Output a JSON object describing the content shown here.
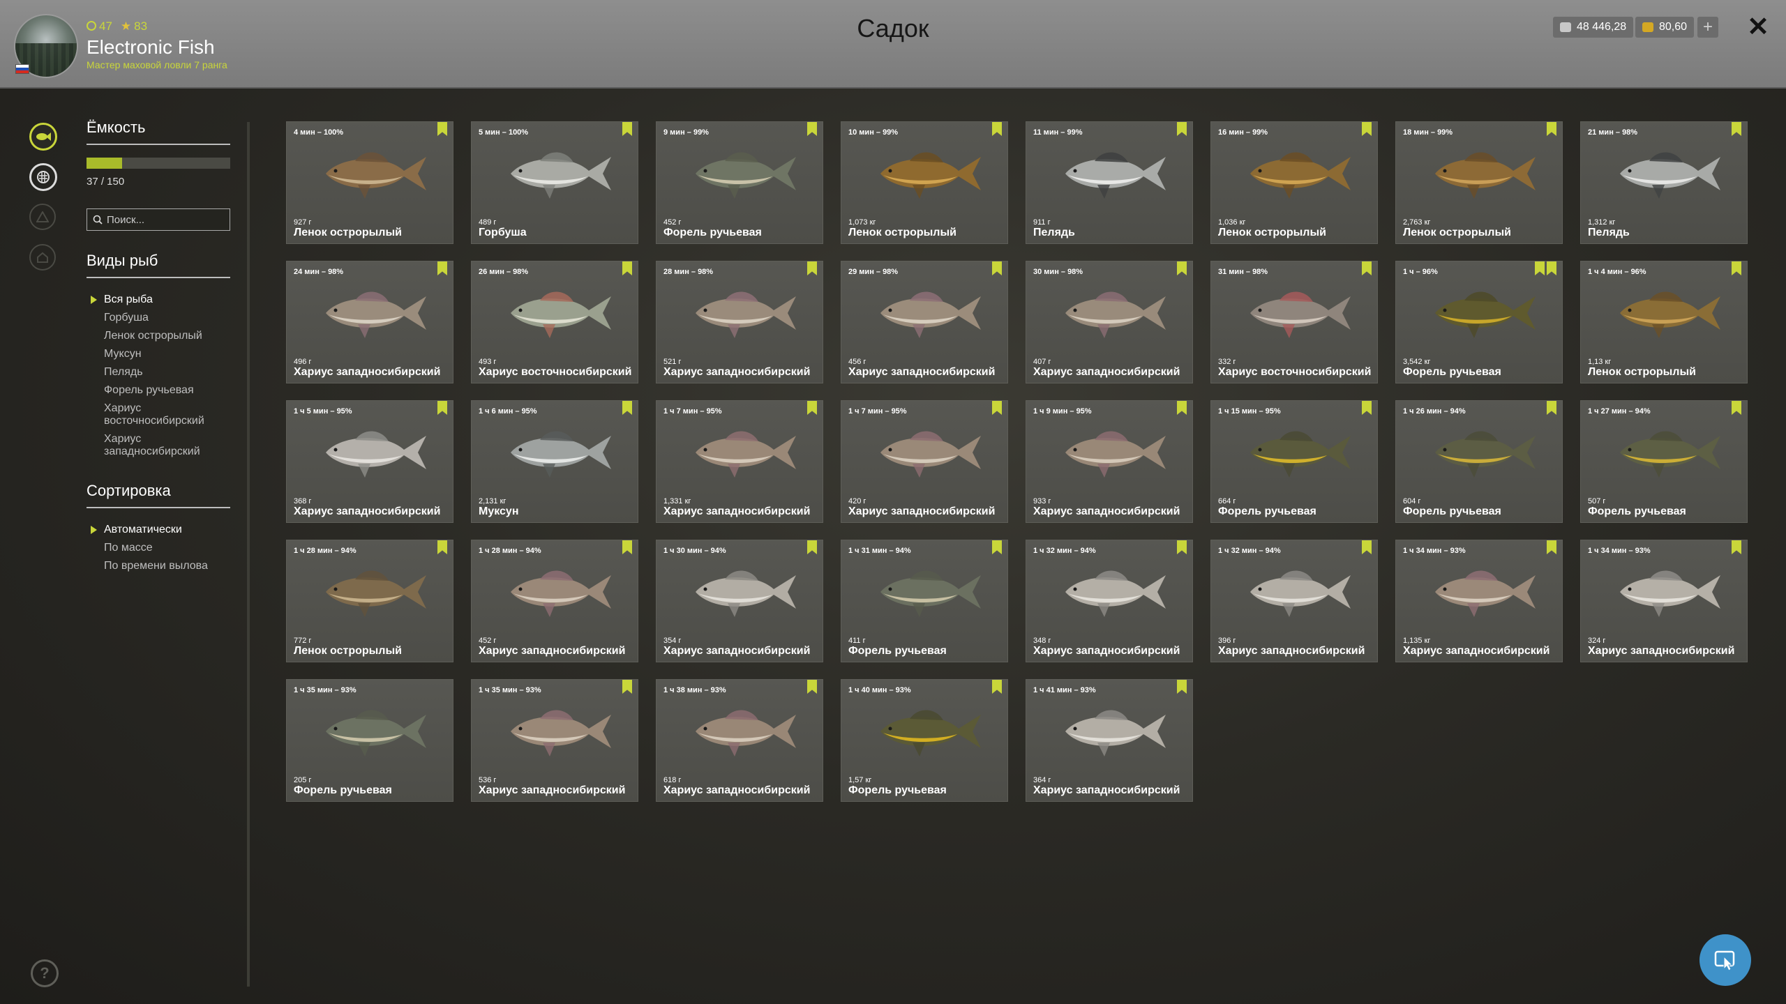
{
  "header": {
    "title": "Садок",
    "level": "47",
    "stars": "83",
    "player_name": "Electronic Fish",
    "player_rank": "Мастер маховой ловли 7 ранга",
    "silver": "48 446,28",
    "gold": "80,60",
    "add_label": "+",
    "close_label": "✕"
  },
  "sidebar": {
    "capacity_title": "Ёмкость",
    "capacity_count": "37 / 150",
    "capacity_fraction": 0.247,
    "search_placeholder": "Поиск...",
    "species_title": "Виды рыб",
    "species": [
      {
        "label": "Вся рыба",
        "selected": true
      },
      {
        "label": "Горбуша",
        "selected": false
      },
      {
        "label": "Ленок острорылый",
        "selected": false
      },
      {
        "label": "Муксун",
        "selected": false
      },
      {
        "label": "Пелядь",
        "selected": false
      },
      {
        "label": "Форель ручьевая",
        "selected": false
      },
      {
        "label": "Хариус восточносибирский",
        "selected": false
      },
      {
        "label": "Хариус западносибирский",
        "selected": false
      }
    ],
    "sort_title": "Сортировка",
    "sort_options": [
      {
        "label": "Автоматически",
        "selected": true
      },
      {
        "label": "По массе",
        "selected": false
      },
      {
        "label": "По времени вылова",
        "selected": false
      }
    ]
  },
  "fish": [
    {
      "time": "4 мин – 100%",
      "weight": "927 г",
      "name": "Ленок острорылый",
      "marks": 1,
      "body": "#8a6c48",
      "belly": "#c7b08a",
      "fin": "#6b5238"
    },
    {
      "time": "5 мин – 100%",
      "weight": "489 г",
      "name": "Горбуша",
      "marks": 1,
      "body": "#a9aaa4",
      "belly": "#e4e4df",
      "fin": "#7e807a"
    },
    {
      "time": "9 мин – 99%",
      "weight": "452 г",
      "name": "Форель ручьевая",
      "marks": 1,
      "body": "#6f7564",
      "belly": "#c9c2a8",
      "fin": "#5a5e4e"
    },
    {
      "time": "10 мин – 99%",
      "weight": "1,073 кг",
      "name": "Ленок острорылый",
      "marks": 1,
      "body": "#8f6a2f",
      "belly": "#d1a450",
      "fin": "#6a4d22"
    },
    {
      "time": "11 мин – 99%",
      "weight": "911 г",
      "name": "Пелядь",
      "marks": 1,
      "body": "#a9aba8",
      "belly": "#e8e8e6",
      "fin": "#3e4040"
    },
    {
      "time": "16 мин – 99%",
      "weight": "1,036 кг",
      "name": "Ленок острорылый",
      "marks": 1,
      "body": "#8c6a33",
      "belly": "#cfa351",
      "fin": "#6b4d24"
    },
    {
      "time": "18 мин – 99%",
      "weight": "2,763 кг",
      "name": "Ленок острорылый",
      "marks": 1,
      "body": "#8d6a36",
      "belly": "#c99e57",
      "fin": "#6a4e28"
    },
    {
      "time": "21 мин – 98%",
      "weight": "1,312 кг",
      "name": "Пелядь",
      "marks": 1,
      "body": "#a8aaa7",
      "belly": "#e5e5e3",
      "fin": "#404242"
    },
    {
      "time": "24 мин – 98%",
      "weight": "496 г",
      "name": "Хариус западносибирский",
      "marks": 1,
      "body": "#9a8c7c",
      "belly": "#d6cdbf",
      "fin": "#8b6e74"
    },
    {
      "time": "26 мин – 98%",
      "weight": "493 г",
      "name": "Хариус восточносибирский",
      "marks": 1,
      "body": "#9aa08e",
      "belly": "#dcdccd",
      "fin": "#a66a5a"
    },
    {
      "time": "28 мин – 98%",
      "weight": "521 г",
      "name": "Хариус западносибирский",
      "marks": 1,
      "body": "#9a8b7b",
      "belly": "#d5cbbc",
      "fin": "#8e7076"
    },
    {
      "time": "29 мин – 98%",
      "weight": "456 г",
      "name": "Хариус западносибирский",
      "marks": 1,
      "body": "#9b8c7b",
      "belly": "#d6ccbd",
      "fin": "#8d6f75"
    },
    {
      "time": "30 мин – 98%",
      "weight": "407 г",
      "name": "Хариус западносибирский",
      "marks": 1,
      "body": "#998b7b",
      "belly": "#d4cabb",
      "fin": "#8b6d73"
    },
    {
      "time": "31 мин – 98%",
      "weight": "332 г",
      "name": "Хариус восточносибирский",
      "marks": 1,
      "body": "#8f857c",
      "belly": "#d0c5ba",
      "fin": "#a65a5a"
    },
    {
      "time": "1 ч – 96%",
      "weight": "3,542 кг",
      "name": "Форель ручьевая",
      "marks": 2,
      "body": "#5f5a2e",
      "belly": "#c7a62a",
      "fin": "#4d4a28"
    },
    {
      "time": "1 ч 4 мин – 96%",
      "weight": "1,13 кг",
      "name": "Ленок острорылый",
      "marks": 1,
      "body": "#8a6d36",
      "belly": "#c9a055",
      "fin": "#6a5028"
    },
    {
      "time": "1 ч 5 мин – 95%",
      "weight": "368 г",
      "name": "Хариус западносибирский",
      "marks": 1,
      "body": "#b4b0aa",
      "belly": "#e2dfda",
      "fin": "#8d8d88"
    },
    {
      "time": "1 ч 6 мин – 95%",
      "weight": "2,131 кг",
      "name": "Муксун",
      "marks": 1,
      "body": "#9ea2a0",
      "belly": "#e4e6e4",
      "fin": "#585c5a"
    },
    {
      "time": "1 ч 7 мин – 95%",
      "weight": "1,331 кг",
      "name": "Хариус западносибирский",
      "marks": 1,
      "body": "#9a8877",
      "belly": "#d4c8b8",
      "fin": "#8e6e70"
    },
    {
      "time": "1 ч 7 мин – 95%",
      "weight": "420 г",
      "name": "Хариус западносибирский",
      "marks": 1,
      "body": "#9a8978",
      "belly": "#d4c9b9",
      "fin": "#8d6d71"
    },
    {
      "time": "1 ч 9 мин – 95%",
      "weight": "933 г",
      "name": "Хариус западносибирский",
      "marks": 1,
      "body": "#998877",
      "belly": "#d3c7b7",
      "fin": "#8c6c70"
    },
    {
      "time": "1 ч 15 мин – 95%",
      "weight": "664 г",
      "name": "Форель ручьевая",
      "marks": 1,
      "body": "#5a5a3c",
      "belly": "#d0b02c",
      "fin": "#4a4a34"
    },
    {
      "time": "1 ч 26 мин – 94%",
      "weight": "604 г",
      "name": "Форель ручьевая",
      "marks": 1,
      "body": "#5c5d44",
      "belly": "#c9ac3a",
      "fin": "#4b4c38"
    },
    {
      "time": "1 ч 27 мин – 94%",
      "weight": "507 г",
      "name": "Форель ручьевая",
      "marks": 1,
      "body": "#5d5f44",
      "belly": "#ccae36",
      "fin": "#4c4d38"
    },
    {
      "time": "1 ч 28 мин – 94%",
      "weight": "772 г",
      "name": "Ленок острорылый",
      "marks": 1,
      "body": "#7e6a4c",
      "belly": "#c3ae88",
      "fin": "#62523c"
    },
    {
      "time": "1 ч 28 мин – 94%",
      "weight": "452 г",
      "name": "Хариус западносибирский",
      "marks": 1,
      "body": "#9a8878",
      "belly": "#d4c8b9",
      "fin": "#8d6d72"
    },
    {
      "time": "1 ч 30 мин – 94%",
      "weight": "354 г",
      "name": "Хариус западносибирский",
      "marks": 1,
      "body": "#b2ada4",
      "belly": "#e0ddd6",
      "fin": "#8c8a84"
    },
    {
      "time": "1 ч 31 мин – 94%",
      "weight": "411 г",
      "name": "Форель ручьевая",
      "marks": 1,
      "body": "#6b7060",
      "belly": "#c6bfa2",
      "fin": "#575b4c"
    },
    {
      "time": "1 ч 32 мин – 94%",
      "weight": "348 г",
      "name": "Хариус западносибирский",
      "marks": 1,
      "body": "#b4afa6",
      "belly": "#e2dfd8",
      "fin": "#8d8b86"
    },
    {
      "time": "1 ч 32 мин – 94%",
      "weight": "396 г",
      "name": "Хариус западносибирский",
      "marks": 1,
      "body": "#b3aea5",
      "belly": "#e1ded7",
      "fin": "#8c8a85"
    },
    {
      "time": "1 ч 34 мин – 93%",
      "weight": "1,135 кг",
      "name": "Хариус западносибирский",
      "marks": 1,
      "body": "#9b8979",
      "belly": "#d5c9ba",
      "fin": "#8e6e73"
    },
    {
      "time": "1 ч 34 мин – 93%",
      "weight": "324 г",
      "name": "Хариус западносибирский",
      "marks": 1,
      "body": "#b5b0a7",
      "belly": "#e3e0d9",
      "fin": "#8e8c87"
    },
    {
      "time": "1 ч 35 мин – 93%",
      "weight": "205 г",
      "name": "Форель ручьевая",
      "marks": 0,
      "body": "#6c7262",
      "belly": "#c8c1a5",
      "fin": "#585c4d"
    },
    {
      "time": "1 ч 35 мин – 93%",
      "weight": "536 г",
      "name": "Хариус западносибирский",
      "marks": 1,
      "body": "#9a8877",
      "belly": "#d4c8b8",
      "fin": "#8d6d71"
    },
    {
      "time": "1 ч 38 мин – 93%",
      "weight": "618 г",
      "name": "Хариус западносибирский",
      "marks": 1,
      "body": "#998776",
      "belly": "#d3c7b7",
      "fin": "#8c6c70"
    },
    {
      "time": "1 ч 40 мин – 93%",
      "weight": "1,57 кг",
      "name": "Форель ручьевая",
      "marks": 1,
      "body": "#5b5a36",
      "belly": "#d2ae22",
      "fin": "#4a4a30"
    },
    {
      "time": "1 ч 41 мин – 93%",
      "weight": "364 г",
      "name": "Хариус западносибирский",
      "marks": 1,
      "body": "#b3aea5",
      "belly": "#e1ded7",
      "fin": "#8c8a85"
    }
  ],
  "colors": {
    "accent": "#c9d63a",
    "card_bg": "#55554f",
    "header_bg": "#878787",
    "cursor_button": "#3f92c9"
  },
  "icons": {
    "rail": [
      "fish-icon",
      "keepnet-icon",
      "camp-icon",
      "home-icon"
    ],
    "help": "help-icon",
    "cursor": "cursor-icon"
  }
}
